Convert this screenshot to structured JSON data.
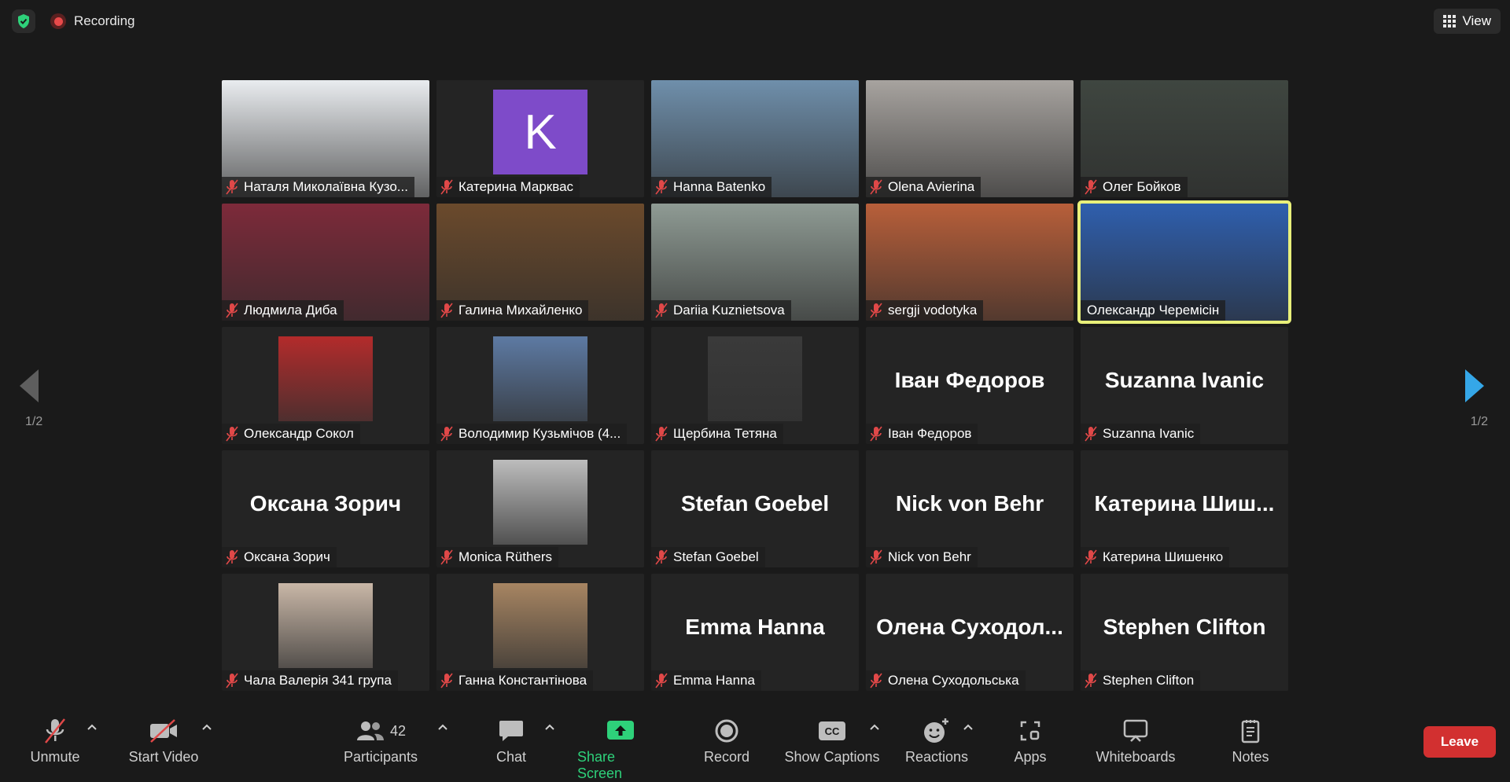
{
  "top": {
    "recording_label": "Recording",
    "view_label": "View",
    "accent": "#2ed17a"
  },
  "pagination": {
    "left": "1/2",
    "right": "1/2"
  },
  "tiles": [
    {
      "name": "Наталя Миколаївна Кузо...",
      "kind": "photo",
      "bg": "#e9ecef",
      "muted": true
    },
    {
      "name": "Катерина Марквас",
      "kind": "initial",
      "initial": "K",
      "muted": true
    },
    {
      "name": "Hanna Batenko",
      "kind": "photo",
      "bg": "#6f8fab",
      "muted": true
    },
    {
      "name": "Olena Avierina",
      "kind": "photo",
      "bg": "#a7a39f",
      "muted": true
    },
    {
      "name": "Олег Бойков",
      "kind": "photo",
      "bg": "#3f4640",
      "muted": true
    },
    {
      "name": "Людмила Диба",
      "kind": "photo",
      "bg": "#7d2a3a",
      "muted": true
    },
    {
      "name": "Галина Михайленко",
      "kind": "photo",
      "bg": "#6b4a2c",
      "muted": true
    },
    {
      "name": "Dariia Kuznietsova",
      "kind": "photo",
      "bg": "#8f9b94",
      "muted": true
    },
    {
      "name": "sergji vodotyka",
      "kind": "photo",
      "bg": "#b85f3a",
      "muted": true
    },
    {
      "name": "Олександр Черемісін",
      "kind": "photo",
      "bg": "#2f5fae",
      "muted": false,
      "active": true
    },
    {
      "name": "Олександр Сокол",
      "kind": "thumb",
      "bg": "#b32b2b",
      "muted": true
    },
    {
      "name": "Володимир Кузьмічов (4...",
      "kind": "thumb",
      "bg": "#5d7aa3",
      "muted": true
    },
    {
      "name": "Щербина Тетяна",
      "kind": "thumb",
      "bg": "#3a3a3a",
      "muted": true
    },
    {
      "name": "Іван Федоров",
      "kind": "text",
      "big": "Іван Федоров",
      "muted": true
    },
    {
      "name": "Suzanna Ivanic",
      "kind": "text",
      "big": "Suzanna Ivanic",
      "muted": true
    },
    {
      "name": "Оксана Зорич",
      "kind": "text",
      "big": "Оксана Зорич",
      "muted": true
    },
    {
      "name": "Monica Rüthers",
      "kind": "thumb",
      "bg": "#bdbdbd",
      "muted": true
    },
    {
      "name": "Stefan Goebel",
      "kind": "text",
      "big": "Stefan Goebel",
      "muted": true
    },
    {
      "name": "Nick von Behr",
      "kind": "text",
      "big": "Nick von Behr",
      "muted": true
    },
    {
      "name": "Катерина Шишенко",
      "kind": "text",
      "big": "Катерина  Шиш...",
      "muted": true
    },
    {
      "name": "Чала Валерія 341 група",
      "kind": "thumb",
      "bg": "#c9b7a7",
      "muted": true
    },
    {
      "name": "Ганна Константінова",
      "kind": "thumb",
      "bg": "#a78562",
      "muted": true
    },
    {
      "name": "Emma Hanna",
      "kind": "text",
      "big": "Emma Hanna",
      "muted": true
    },
    {
      "name": "Олена Суходольська",
      "kind": "text",
      "big": "Олена  Суходол...",
      "muted": true
    },
    {
      "name": "Stephen Clifton",
      "kind": "text",
      "big": "Stephen Clifton",
      "muted": true
    }
  ],
  "toolbar": {
    "unmute": "Unmute",
    "start_video": "Start Video",
    "participants": "Participants",
    "participants_count": "42",
    "chat": "Chat",
    "share_screen": "Share Screen",
    "record": "Record",
    "show_captions": "Show Captions",
    "reactions": "Reactions",
    "apps": "Apps",
    "whiteboards": "Whiteboards",
    "notes": "Notes",
    "leave": "Leave",
    "leave_color": "#d23030"
  }
}
